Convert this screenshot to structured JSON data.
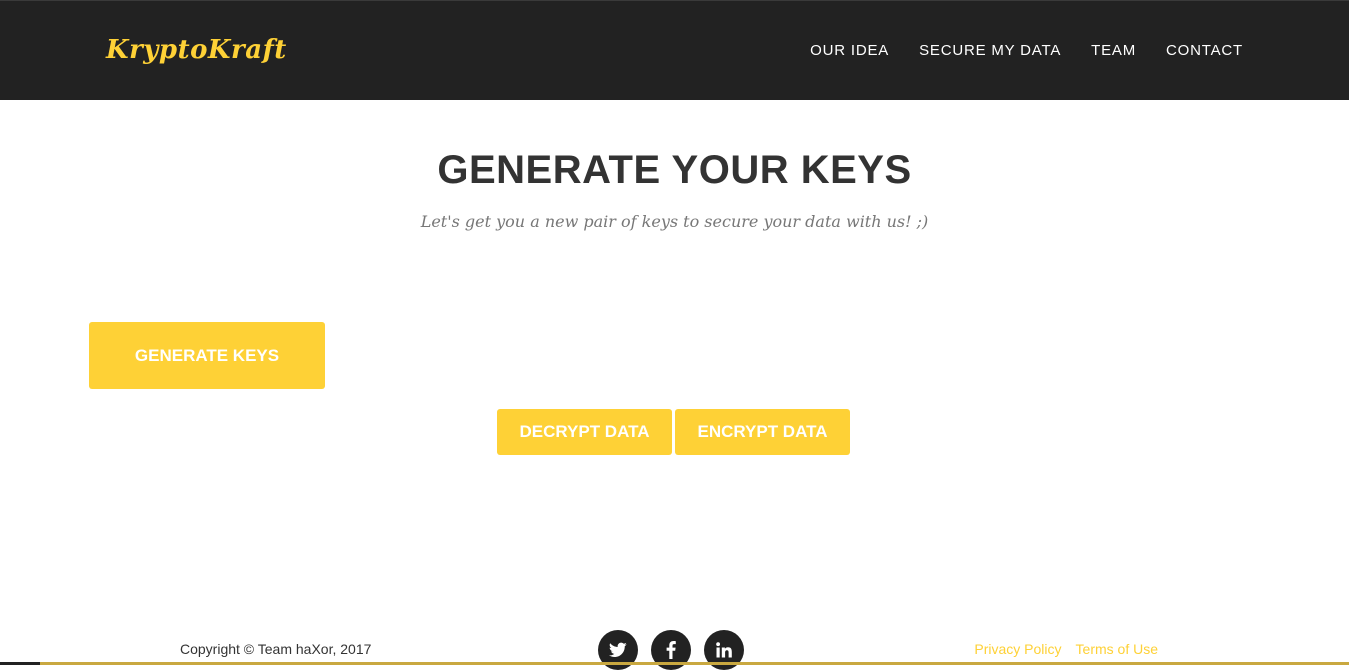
{
  "header": {
    "brand": "KryptoKraft",
    "nav": [
      {
        "label": "OUR IDEA"
      },
      {
        "label": "SECURE MY DATA"
      },
      {
        "label": "TEAM"
      },
      {
        "label": "CONTACT"
      }
    ]
  },
  "main": {
    "title": "GENERATE YOUR KEYS",
    "subtitle": "Let's get you a new pair of keys to secure your data with us! ;)",
    "generate_label": "GENERATE KEYS",
    "decrypt_label": "DECRYPT DATA",
    "encrypt_label": "ENCRYPT DATA"
  },
  "footer": {
    "copyright": "Copyright © Team haXor, 2017",
    "social": [
      {
        "icon": "twitter-icon"
      },
      {
        "icon": "facebook-icon"
      },
      {
        "icon": "linkedin-icon"
      }
    ],
    "links": [
      {
        "label": "Privacy Policy"
      },
      {
        "label": "Terms of Use"
      }
    ]
  },
  "colors": {
    "accent": "#fed136",
    "navbar_bg": "#222222",
    "heading": "#333333",
    "muted": "#777777"
  }
}
